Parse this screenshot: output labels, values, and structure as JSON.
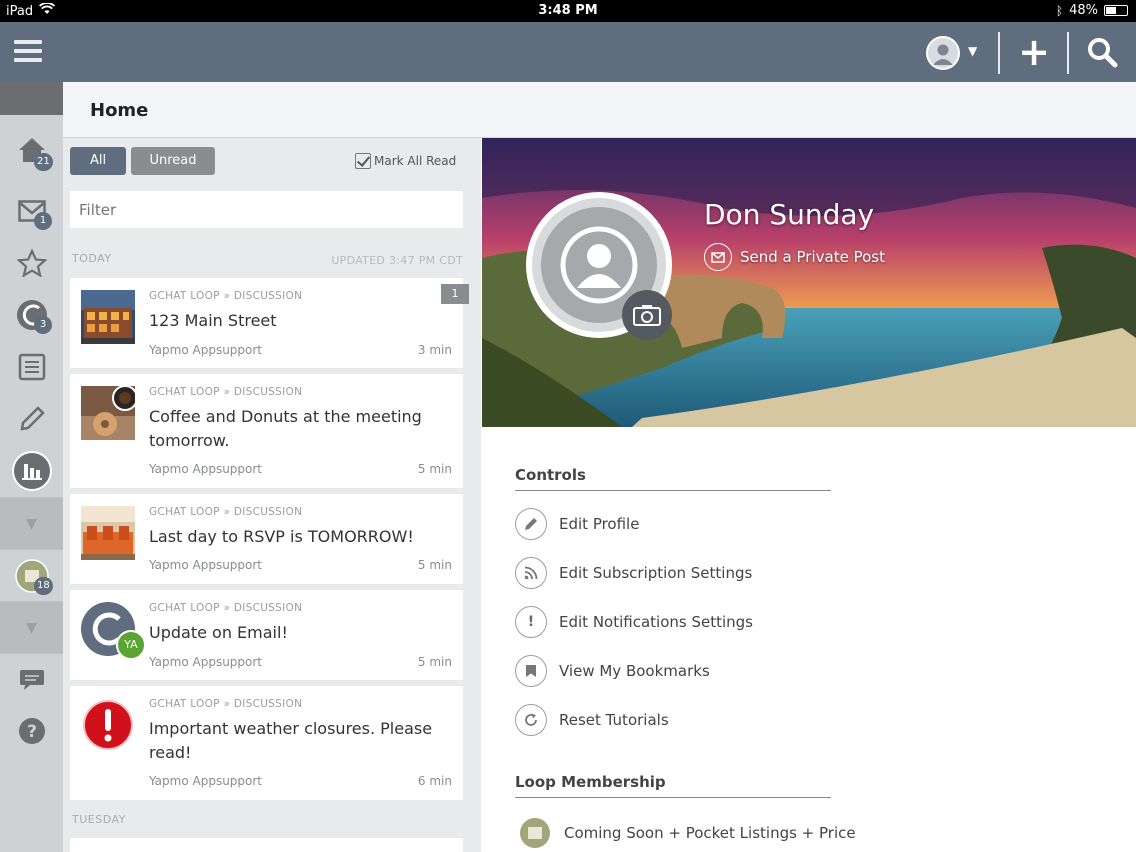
{
  "status_bar": {
    "device": "iPad",
    "time": "3:48 PM",
    "battery": "48%"
  },
  "page": {
    "title": "Home"
  },
  "feed": {
    "filter_all": "All",
    "filter_unread": "Unread",
    "mark_all_read": "Mark All Read",
    "filter_placeholder": "Filter",
    "section_today": "TODAY",
    "updated": "UPDATED 3:47 PM CDT",
    "section_tuesday": "TUESDAY",
    "posts": [
      {
        "meta": "GCHAT LOOP » DISCUSSION",
        "title": "123 Main Street",
        "author": "Yapmo Appsupport",
        "time": "3 min",
        "badge": "1"
      },
      {
        "meta": "GCHAT LOOP » DISCUSSION",
        "title": "Coffee and Donuts at the meeting tomorrow.",
        "author": "Yapmo Appsupport",
        "time": "5 min"
      },
      {
        "meta": "GCHAT LOOP » DISCUSSION",
        "title": "Last day to RSVP is TOMORROW!",
        "author": "Yapmo Appsupport",
        "time": "5 min"
      },
      {
        "meta": "GCHAT LOOP » DISCUSSION",
        "title": "Update on Email!",
        "author": "Yapmo Appsupport",
        "time": "5 min",
        "avatar_initials": "YA"
      },
      {
        "meta": "GCHAT LOOP » DISCUSSION",
        "title": "Important weather closures. Please read!",
        "author": "Yapmo Appsupport",
        "time": "6 min"
      }
    ]
  },
  "rail": {
    "home_badge": "21",
    "mail_badge": "1",
    "loops_badge": "3",
    "loop_badge": "18"
  },
  "profile": {
    "name": "Don Sunday",
    "send_private_post": "Send a Private Post",
    "controls_heading": "Controls",
    "controls": [
      {
        "label": "Edit Profile",
        "icon": "pencil-icon"
      },
      {
        "label": "Edit Subscription Settings",
        "icon": "rss-icon"
      },
      {
        "label": "Edit Notifications Settings",
        "icon": "exclamation-icon"
      },
      {
        "label": "View My Bookmarks",
        "icon": "bookmark-icon"
      },
      {
        "label": "Reset Tutorials",
        "icon": "refresh-icon"
      }
    ],
    "loop_heading": "Loop Membership",
    "loops": [
      {
        "label": "Coming Soon + Pocket Listings + Price"
      }
    ]
  },
  "colors": {
    "nav": "#5f6d7f",
    "rail": "#cfd2d4",
    "feed_bg": "#e9eaeb",
    "alert": "#d0101a",
    "initials": "#5aa531"
  }
}
